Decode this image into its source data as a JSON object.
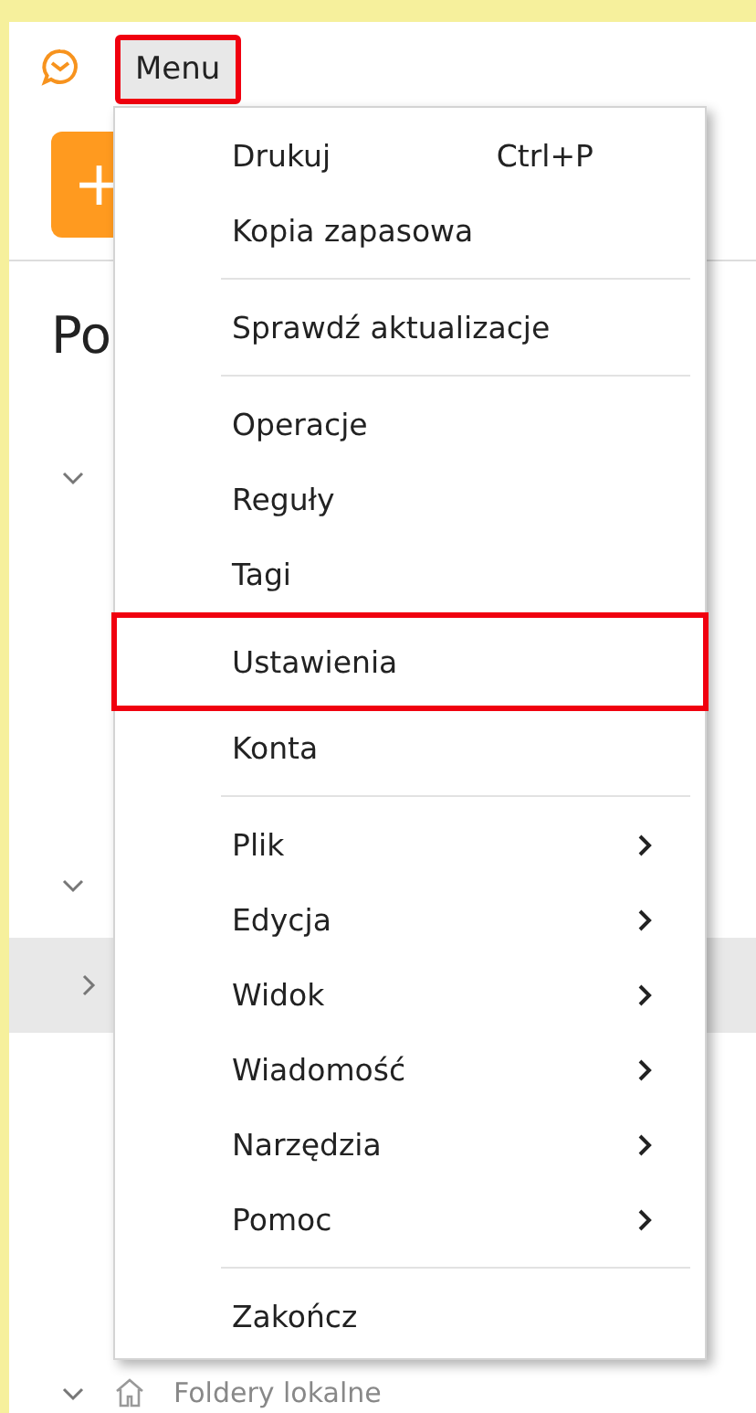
{
  "toolbar": {
    "menu_button": {
      "label": "Menu",
      "highlighted": true
    },
    "new_button": {
      "label": "+"
    }
  },
  "folder_pane": {
    "heading": "Po",
    "rows": [
      {
        "expanded": true,
        "selected": false
      },
      {
        "expanded": true,
        "selected": false
      },
      {
        "expanded": false,
        "selected": true
      },
      {
        "expanded": true,
        "selected": false,
        "label": "Foldery lokalne"
      }
    ]
  },
  "menu": {
    "items": [
      {
        "kind": "item",
        "label": "Drukuj",
        "shortcut": "Ctrl+P",
        "highlighted": false
      },
      {
        "kind": "item",
        "label": "Kopia zapasowa",
        "highlighted": false
      },
      {
        "kind": "separator"
      },
      {
        "kind": "item",
        "label": "Sprawdź aktualizacje",
        "highlighted": false
      },
      {
        "kind": "separator"
      },
      {
        "kind": "item",
        "label": "Operacje",
        "highlighted": false
      },
      {
        "kind": "item",
        "label": "Reguły",
        "highlighted": false
      },
      {
        "kind": "item",
        "label": "Tagi",
        "highlighted": false
      },
      {
        "kind": "item",
        "label": "Ustawienia",
        "highlighted": true
      },
      {
        "kind": "item",
        "label": "Konta",
        "highlighted": false
      },
      {
        "kind": "separator"
      },
      {
        "kind": "submenu",
        "label": "Plik",
        "highlighted": false
      },
      {
        "kind": "submenu",
        "label": "Edycja",
        "highlighted": false
      },
      {
        "kind": "submenu",
        "label": "Widok",
        "highlighted": false
      },
      {
        "kind": "submenu",
        "label": "Wiadomość",
        "highlighted": false
      },
      {
        "kind": "submenu",
        "label": "Narzędzia",
        "highlighted": false
      },
      {
        "kind": "submenu",
        "label": "Pomoc",
        "highlighted": false
      },
      {
        "kind": "separator"
      },
      {
        "kind": "item",
        "label": "Zakończ",
        "highlighted": false
      }
    ]
  }
}
